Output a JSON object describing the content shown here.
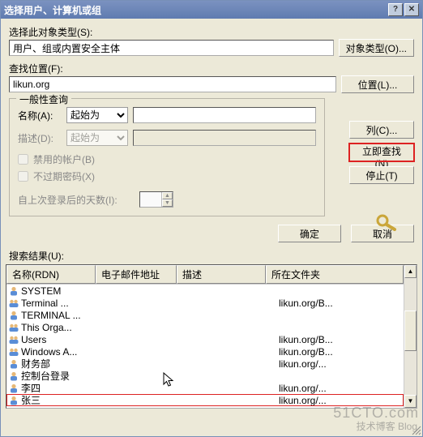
{
  "title": "选择用户、计算机或组",
  "labels": {
    "object_type_label": "选择此对象类型(S):",
    "object_type_value": "用户、组或内置安全主体",
    "object_types_btn": "对象类型(O)...",
    "location_label": "查找位置(F):",
    "location_value": "likun.org",
    "location_btn": "位置(L)...",
    "general_query": "一般性查询",
    "name_label": "名称(A):",
    "name_op": "起始为",
    "desc_label": "描述(D):",
    "desc_op": "起始为",
    "disabled_accounts": "禁用的帐户(B)",
    "nonexpiring": "不过期密码(X)",
    "days_since_login": "自上次登录后的天数(I):",
    "columns_btn": "列(C)...",
    "find_now_btn": "立即查找(N)",
    "stop_btn": "停止(T)",
    "ok_btn": "确定",
    "cancel_btn": "取消",
    "results_label": "搜索结果(U):"
  },
  "columns": {
    "c1": "名称(RDN)",
    "c2": "电子邮件地址",
    "c3": "描述",
    "c4": "所在文件夹"
  },
  "rows": [
    {
      "icon": "user",
      "name": "SYSTEM",
      "folder": ""
    },
    {
      "icon": "group",
      "name": "Terminal ...",
      "folder": "likun.org/B..."
    },
    {
      "icon": "user",
      "name": "TERMINAL ...",
      "folder": ""
    },
    {
      "icon": "group",
      "name": "This Orga...",
      "folder": ""
    },
    {
      "icon": "group",
      "name": "Users",
      "folder": "likun.org/B..."
    },
    {
      "icon": "group",
      "name": "Windows A...",
      "folder": "likun.org/B..."
    },
    {
      "icon": "user",
      "name": "财务部",
      "folder": "likun.org/..."
    },
    {
      "icon": "user",
      "name": "控制台登录",
      "folder": ""
    },
    {
      "icon": "user",
      "name": "李四",
      "folder": "likun.org/..."
    },
    {
      "icon": "user",
      "name": "张三",
      "folder": "likun.org/...",
      "highlight": true
    }
  ],
  "watermark": {
    "big": "51CTO.com",
    "small": "技术博客  Blog"
  }
}
